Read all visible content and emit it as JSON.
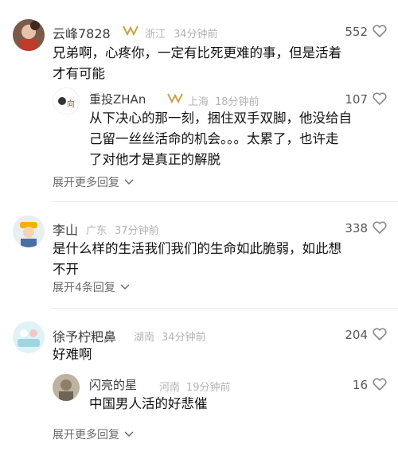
{
  "comments": [
    {
      "user": "云峰7828",
      "location": "浙江",
      "time": "34分钟前",
      "likes": "552",
      "text_lines": [
        "兄弟啊，心疼你，一定有比死更难的事，但是活着",
        "才有可能"
      ],
      "reply": {
        "user": "重投ZHAn",
        "location": "上海",
        "time": "18分钟前",
        "likes": "107",
        "text_lines": [
          "从下决心的那一刻，捆住双手双脚，他没给自",
          "己留一丝丝活命的机会。。。太累了，也许走",
          "了对他才是真正的解脱"
        ]
      },
      "expand_label": "展开更多回复"
    },
    {
      "user": "李山",
      "location": "广东",
      "time": "37分钟前",
      "likes": "338",
      "text_lines": [
        "是什么样的生活我们我们的生命如此脆弱，如此想",
        "不开"
      ],
      "expand_label": "展开4条回复"
    },
    {
      "user": "徐予柠粑鼻",
      "location": "湖南",
      "time": "34分钟前",
      "likes": "204",
      "text_lines": [
        "好难啊"
      ],
      "reply": {
        "user": "闪亮的星",
        "location": "河南",
        "time": "19分钟前",
        "likes": "16",
        "text_lines": [
          "中国男人活的好悲催"
        ]
      },
      "expand_label": "展开更多回复"
    }
  ],
  "colors": {
    "vip_gold": "#c9a24a",
    "meta_gray": "#b3b3b3",
    "divider": "#ededed"
  },
  "icons": {
    "like": "heart-outline-icon",
    "expand": "chevron-down-icon",
    "badge": "vip-badge-icon"
  }
}
